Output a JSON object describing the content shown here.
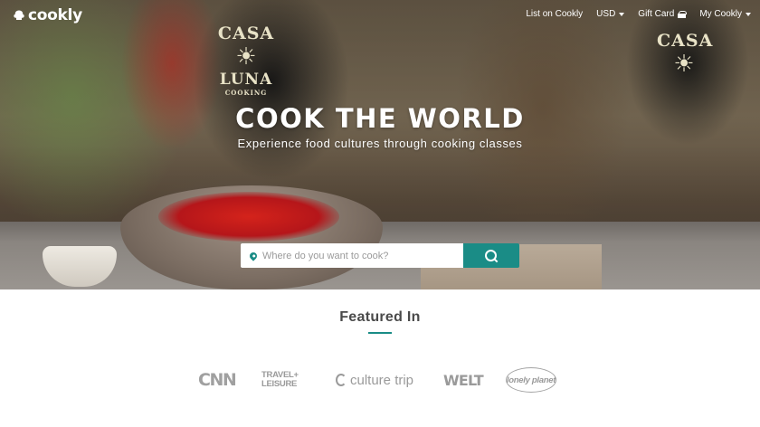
{
  "brand": {
    "name": "cookly",
    "accent": "#1a8c86"
  },
  "nav": {
    "list_on": "List on Cookly",
    "currency": "USD",
    "gift_card": "Gift Card",
    "account": "My Cookly"
  },
  "hero": {
    "headline": "COOK THE WORLD",
    "subline": "Experience food cultures through cooking classes",
    "apron_text": {
      "line1": "CASA",
      "line2": "LUNA",
      "line3": "COOKING",
      "line1_right": "CASA"
    }
  },
  "search": {
    "placeholder": "Where do you want to cook?",
    "value": ""
  },
  "featured": {
    "title": "Featured In",
    "logos": [
      "CNN",
      "TRAVEL+ LEISURE",
      "culture trip",
      "WELT",
      "lonely planet"
    ],
    "tl_line1": "TRAVEL+",
    "tl_line2": "LEISURE"
  },
  "icons": {
    "logo": "cookly-hat-icon",
    "gift": "gift-icon",
    "pin": "map-pin-icon",
    "search": "search-icon",
    "caret": "chevron-down-icon"
  }
}
